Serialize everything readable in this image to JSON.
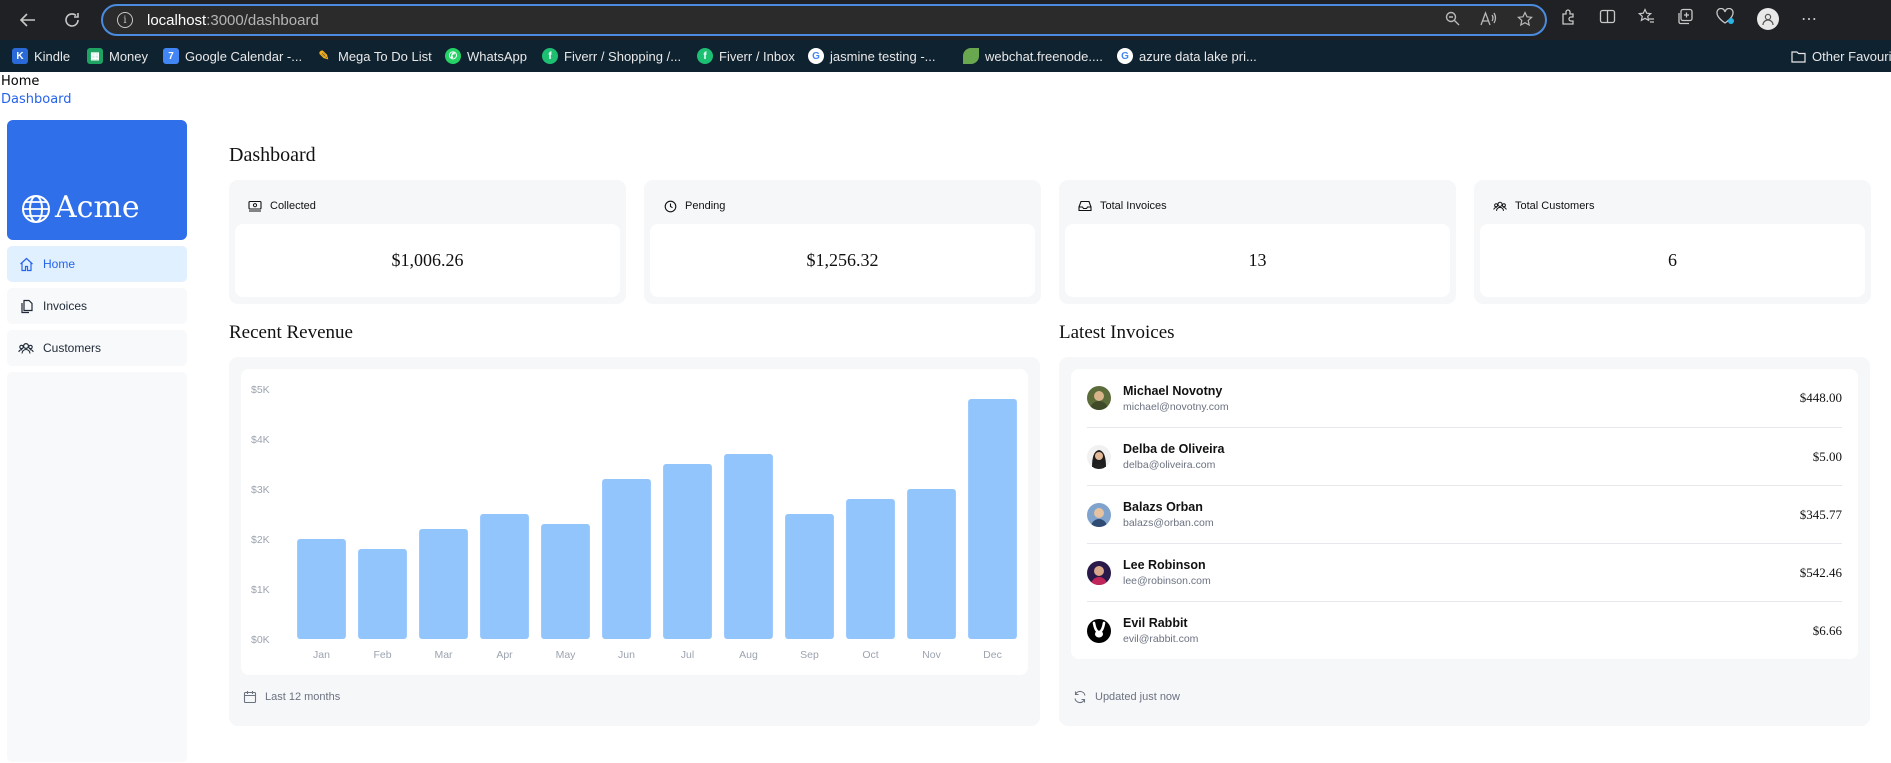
{
  "browser": {
    "url_host": "localhost",
    "url_path": ":3000/dashboard",
    "bookmarks": [
      {
        "label": "Kindle",
        "icon": "kindle-icon",
        "color": "#2a6ad8"
      },
      {
        "label": "Money",
        "icon": "sheets-icon",
        "color": "#1ea362"
      },
      {
        "label": "Google Calendar -...",
        "icon": "calendar-icon",
        "color": "#4285f4"
      },
      {
        "label": "Mega To Do List",
        "icon": "todo-icon",
        "color": "#f2b01e"
      },
      {
        "label": "WhatsApp",
        "icon": "whatsapp-icon",
        "color": "#25d366"
      },
      {
        "label": "Fiverr / Shopping /...",
        "icon": "fiverr-icon",
        "color": "#1dbf73"
      },
      {
        "label": "Fiverr / Inbox",
        "icon": "fiverr-icon",
        "color": "#1dbf73"
      },
      {
        "label": "jasmine testing -...",
        "icon": "google-icon",
        "color": "#ffffff"
      },
      {
        "label": "webchat.freenode....",
        "icon": "freenode-icon",
        "color": "#6aa84f"
      },
      {
        "label": "azure data lake pri...",
        "icon": "google-icon",
        "color": "#ffffff"
      }
    ],
    "other_favourites": "Other Favouri"
  },
  "breadcrumb": {
    "home": "Home",
    "current": "Dashboard"
  },
  "sidebar": {
    "brand": "Acme",
    "brand_color": "#2f6fea",
    "items": [
      {
        "label": "Home",
        "icon": "home-icon",
        "active": true
      },
      {
        "label": "Invoices",
        "icon": "document-icon",
        "active": false
      },
      {
        "label": "Customers",
        "icon": "users-icon",
        "active": false
      }
    ]
  },
  "page_title": "Dashboard",
  "cards": [
    {
      "title": "Collected",
      "icon": "banknotes-icon",
      "value": "$1,006.26"
    },
    {
      "title": "Pending",
      "icon": "clock-icon",
      "value": "$1,256.32"
    },
    {
      "title": "Total Invoices",
      "icon": "inbox-icon",
      "value": "13"
    },
    {
      "title": "Total Customers",
      "icon": "users-icon",
      "value": "6"
    }
  ],
  "revenue": {
    "title": "Recent Revenue",
    "footer": "Last 12 months"
  },
  "chart_data": {
    "type": "bar",
    "categories": [
      "Jan",
      "Feb",
      "Mar",
      "Apr",
      "May",
      "Jun",
      "Jul",
      "Aug",
      "Sep",
      "Oct",
      "Nov",
      "Dec"
    ],
    "values": [
      2000,
      1800,
      2200,
      2500,
      2300,
      3200,
      3500,
      3700,
      2500,
      2800,
      3000,
      4800
    ],
    "yticks": [
      "$0K",
      "$1K",
      "$2K",
      "$3K",
      "$4K",
      "$5K"
    ],
    "ylim": [
      0,
      5000
    ],
    "bar_color": "#93c5fd",
    "title": "",
    "xlabel": "",
    "ylabel": ""
  },
  "latest_invoices": {
    "title": "Latest Invoices",
    "footer": "Updated just now",
    "rows": [
      {
        "name": "Michael Novotny",
        "email": "michael@novotny.com",
        "amount": "$448.00",
        "avatar_color": "#5b6b3a"
      },
      {
        "name": "Delba de Oliveira",
        "email": "delba@oliveira.com",
        "amount": "$5.00",
        "avatar_color": "#2b2b2b"
      },
      {
        "name": "Balazs Orban",
        "email": "balazs@orban.com",
        "amount": "$345.77",
        "avatar_color": "#4a6d9c"
      },
      {
        "name": "Lee Robinson",
        "email": "lee@robinson.com",
        "amount": "$542.46",
        "avatar_color": "#2a1a4a"
      },
      {
        "name": "Evil Rabbit",
        "email": "evil@rabbit.com",
        "amount": "$6.66",
        "avatar_color": "#000000"
      }
    ]
  }
}
